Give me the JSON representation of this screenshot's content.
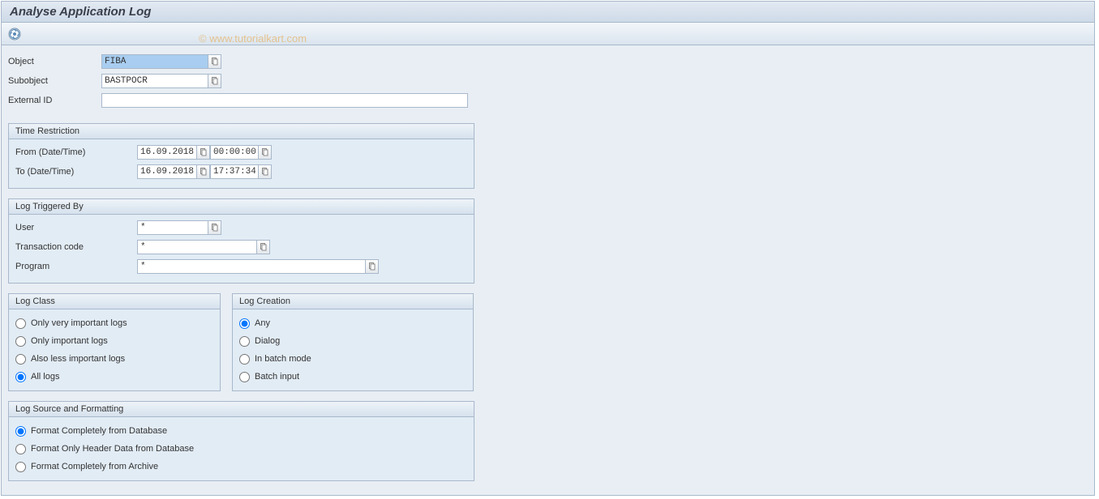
{
  "header": {
    "title": "Analyse Application Log"
  },
  "watermark": "© www.tutorialkart.com",
  "selection": {
    "object_label": "Object",
    "object_value": "FIBA",
    "subobject_label": "Subobject",
    "subobject_value": "BASTPOCR",
    "external_id_label": "External ID",
    "external_id_value": ""
  },
  "time_restriction": {
    "title": "Time Restriction",
    "from_label": "From (Date/Time)",
    "from_date": "16.09.2018",
    "from_time": "00:00:00",
    "to_label": "To (Date/Time)",
    "to_date": "16.09.2018",
    "to_time": "17:37:34"
  },
  "log_triggered": {
    "title": "Log Triggered By",
    "user_label": "User",
    "user_value": "*",
    "tcode_label": "Transaction code",
    "tcode_value": "*",
    "program_label": "Program",
    "program_value": "*"
  },
  "log_class": {
    "title": "Log Class",
    "opt1": "Only very important logs",
    "opt2": "Only important logs",
    "opt3": "Also less important logs",
    "opt4": "All logs",
    "selected": "opt4"
  },
  "log_creation": {
    "title": "Log Creation",
    "opt1": "Any",
    "opt2": "Dialog",
    "opt3": "In batch mode",
    "opt4": "Batch input",
    "selected": "opt1"
  },
  "log_source": {
    "title": "Log Source and Formatting",
    "opt1": "Format Completely from Database",
    "opt2": "Format Only Header Data from Database",
    "opt3": "Format Completely from Archive",
    "selected": "opt1"
  }
}
